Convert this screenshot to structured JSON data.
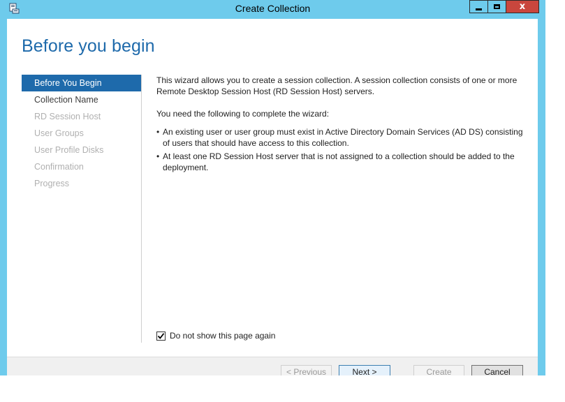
{
  "window": {
    "title": "Create Collection",
    "close_glyph": "x",
    "app_icon": "server-manager-icon"
  },
  "page": {
    "heading": "Before you begin"
  },
  "nav": {
    "items": [
      {
        "label": "Before You Begin",
        "state": "active"
      },
      {
        "label": "Collection Name",
        "state": "enabled"
      },
      {
        "label": "RD Session Host",
        "state": "disabled"
      },
      {
        "label": "User Groups",
        "state": "disabled"
      },
      {
        "label": "User Profile Disks",
        "state": "disabled"
      },
      {
        "label": "Confirmation",
        "state": "disabled"
      },
      {
        "label": "Progress",
        "state": "disabled"
      }
    ]
  },
  "content": {
    "intro": "This wizard allows you to create a session collection. A session collection consists of one or more Remote Desktop Session Host (RD Session Host) servers.",
    "requirements_heading": "You need the following to complete the wizard:",
    "bullets": [
      "An existing user or user group must exist in Active Directory Domain Services (AD DS) consisting of users that should have access to this collection.",
      "At least one RD Session Host server that is not assigned to a collection should be added to the deployment."
    ]
  },
  "options": {
    "dont_show_label": "Do not show this page again",
    "dont_show_checked": true
  },
  "buttons": {
    "previous": "< Previous",
    "next": "Next >",
    "create": "Create",
    "cancel": "Cancel"
  },
  "colors": {
    "frame": "#6ecbec",
    "accent": "#1e6aab",
    "close": "#c9463d"
  }
}
